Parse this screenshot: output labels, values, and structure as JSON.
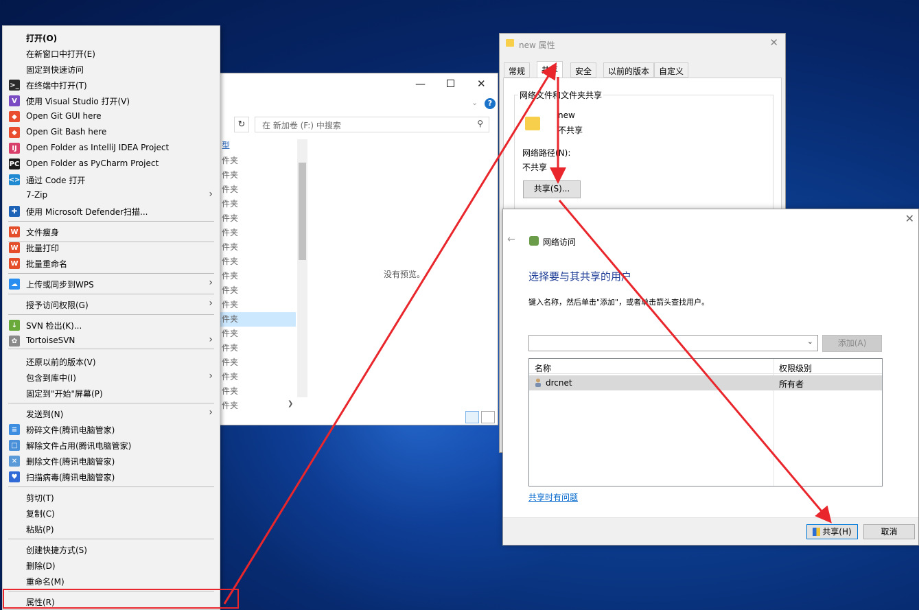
{
  "context_menu": {
    "items": [
      {
        "label": "打开(O)",
        "icon": "none",
        "bold": true,
        "submenu": false
      },
      {
        "label": "在新窗口中打开(E)",
        "icon": "none",
        "submenu": false
      },
      {
        "label": "固定到快速访问",
        "icon": "none",
        "submenu": false
      },
      {
        "label": "在终端中打开(T)",
        "icon": "terminal-icon",
        "submenu": false
      },
      {
        "label": "使用 Visual Studio 打开(V)",
        "icon": "visual-studio-icon",
        "submenu": false
      },
      {
        "label": "Open Git GUI here",
        "icon": "git-gui-icon",
        "submenu": false
      },
      {
        "label": "Open Git Bash here",
        "icon": "git-bash-icon",
        "submenu": false
      },
      {
        "label": "Open Folder as IntelliJ IDEA Project",
        "icon": "intellij-icon",
        "submenu": false
      },
      {
        "label": "Open Folder as PyCharm Project",
        "icon": "pycharm-icon",
        "submenu": false
      },
      {
        "label": "通过 Code 打开",
        "icon": "vscode-icon",
        "submenu": false
      },
      {
        "label": "7-Zip",
        "icon": "none",
        "submenu": true
      },
      {
        "label": "使用 Microsoft Defender扫描...",
        "icon": "defender-icon",
        "submenu": false
      },
      {
        "label": "文件瘦身",
        "icon": "wps-icon",
        "submenu": false
      },
      {
        "label": "批量打印",
        "icon": "wps-icon",
        "submenu": false
      },
      {
        "label": "批量重命名",
        "icon": "wps-icon",
        "submenu": false
      },
      {
        "label": "上传或同步到WPS",
        "icon": "cloud-icon",
        "submenu": true
      },
      {
        "label": "授予访问权限(G)",
        "icon": "none",
        "submenu": true
      },
      {
        "label": "SVN 检出(K)...",
        "icon": "svn-checkout-icon",
        "submenu": false
      },
      {
        "label": "TortoiseSVN",
        "icon": "tortoisesvn-icon",
        "submenu": true
      },
      {
        "label": "还原以前的版本(V)",
        "icon": "none",
        "submenu": false
      },
      {
        "label": "包含到库中(I)",
        "icon": "none",
        "submenu": true
      },
      {
        "label": "固定到\"开始\"屏幕(P)",
        "icon": "none",
        "submenu": false
      },
      {
        "label": "发送到(N)",
        "icon": "none",
        "submenu": true
      },
      {
        "label": "粉碎文件(腾讯电脑管家)",
        "icon": "shred-icon",
        "submenu": false
      },
      {
        "label": "解除文件占用(腾讯电脑管家)",
        "icon": "unlock-file-icon",
        "submenu": false
      },
      {
        "label": "删除文件(腾讯电脑管家)",
        "icon": "delete-file-icon",
        "submenu": false
      },
      {
        "label": "扫描病毒(腾讯电脑管家)",
        "icon": "scan-virus-icon",
        "submenu": false
      },
      {
        "label": "剪切(T)",
        "icon": "none",
        "submenu": false
      },
      {
        "label": "复制(C)",
        "icon": "none",
        "submenu": false
      },
      {
        "label": "粘贴(P)",
        "icon": "none",
        "submenu": false
      },
      {
        "label": "创建快捷方式(S)",
        "icon": "none",
        "submenu": false
      },
      {
        "label": "删除(D)",
        "icon": "none",
        "submenu": false
      },
      {
        "label": "重命名(M)",
        "icon": "none",
        "submenu": false
      },
      {
        "label": "属性(R)",
        "icon": "none",
        "submenu": false,
        "highlighted": true
      }
    ]
  },
  "explorer": {
    "search_placeholder": "在 新加卷 (F:) 中搜索",
    "column_header": "型",
    "rows": [
      "件夹",
      "件夹",
      "件夹",
      "件夹",
      "件夹",
      "件夹",
      "件夹",
      "件夹",
      "件夹",
      "件夹",
      "件夹",
      "件夹",
      "件夹",
      "件夹",
      "件夹",
      "件夹",
      "件夹",
      "件夹"
    ],
    "selected_row_index": 11,
    "no_preview": "没有预览。"
  },
  "properties": {
    "title": "new 属性",
    "tabs": [
      "常规",
      "共享",
      "安全",
      "以前的版本",
      "自定义"
    ],
    "active_tab": "共享",
    "group_title": "网络文件和文件夹共享",
    "folder_name": "new",
    "share_status": "不共享",
    "network_path_label": "网络路径(N):",
    "network_path_value": "不共享",
    "share_button": "共享(S)..."
  },
  "network_access": {
    "window_title": "网络访问",
    "heading": "选择要与其共享的用户",
    "instructions": "键入名称，然后单击\"添加\"，或者单击箭头查找用户。",
    "add_button": "添加(A)",
    "table_headers": [
      "名称",
      "权限级别"
    ],
    "rows": [
      {
        "name": "drcnet",
        "permission": "所有者"
      }
    ],
    "help_link": "共享时有问题",
    "share_button": "共享(H)",
    "cancel_button": "取消"
  },
  "colors": {
    "annotation_red": "#e8262b",
    "heading_blue": "#1e3c96",
    "link_blue": "#0066cc"
  }
}
